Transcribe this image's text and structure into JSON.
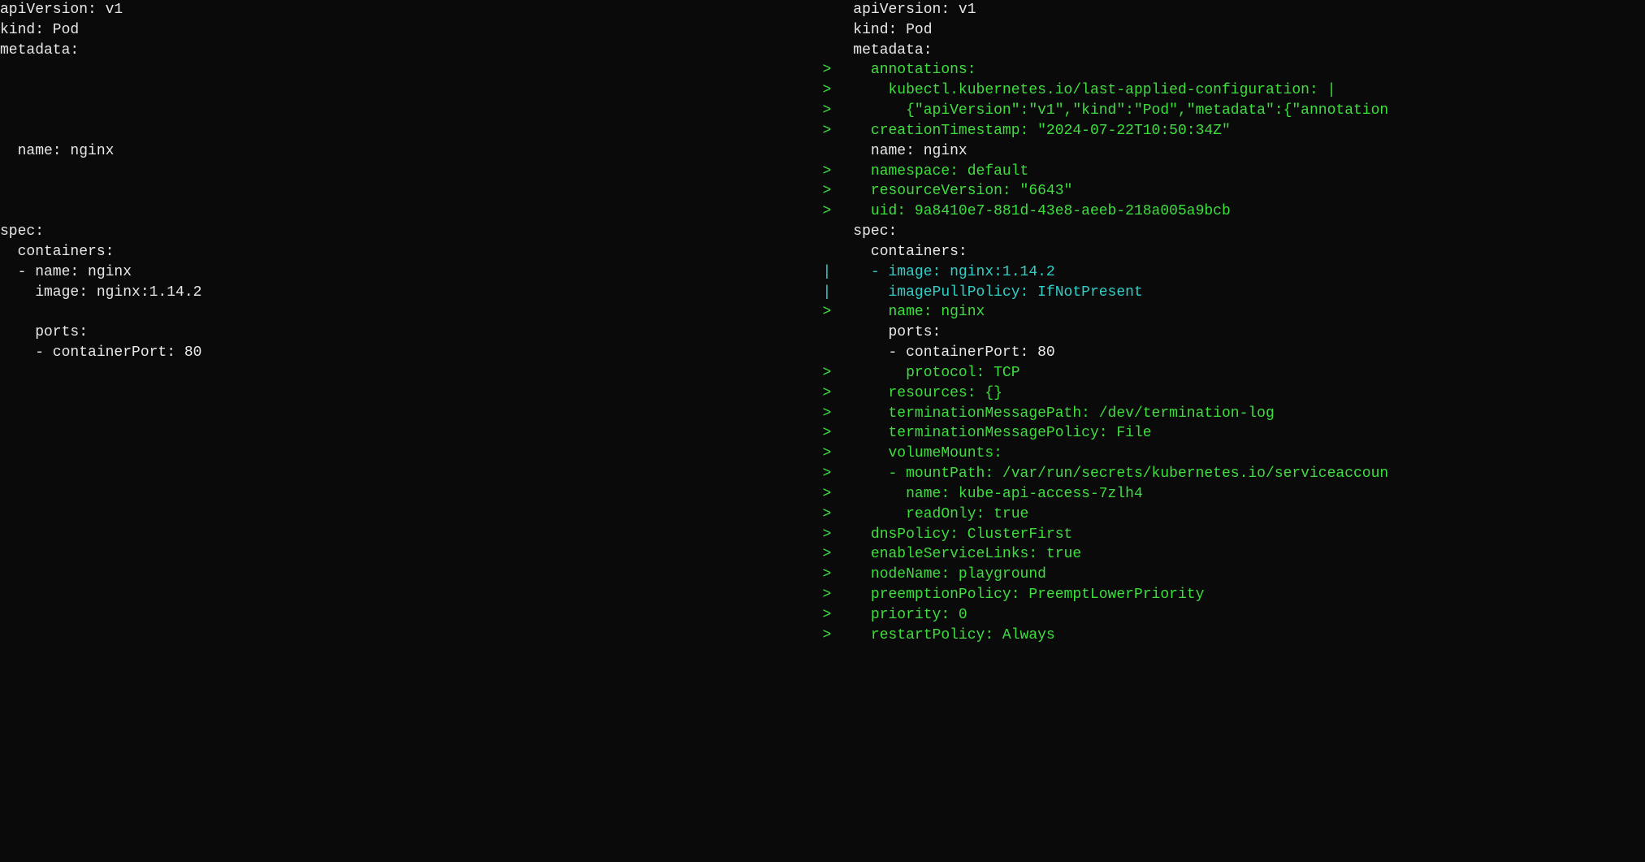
{
  "left": {
    "lines": [
      {
        "marker": "",
        "cls": "normal",
        "text": "apiVersion: v1"
      },
      {
        "marker": "",
        "cls": "normal",
        "text": "kind: Pod"
      },
      {
        "marker": "",
        "cls": "normal",
        "text": "metadata:"
      },
      {
        "marker": "",
        "cls": "normal",
        "text": ""
      },
      {
        "marker": "",
        "cls": "normal",
        "text": ""
      },
      {
        "marker": "",
        "cls": "normal",
        "text": ""
      },
      {
        "marker": "",
        "cls": "normal",
        "text": ""
      },
      {
        "marker": "",
        "cls": "normal",
        "text": "  name: nginx"
      },
      {
        "marker": "",
        "cls": "normal",
        "text": ""
      },
      {
        "marker": "",
        "cls": "normal",
        "text": ""
      },
      {
        "marker": "",
        "cls": "normal",
        "text": ""
      },
      {
        "marker": "",
        "cls": "normal",
        "text": "spec:"
      },
      {
        "marker": "",
        "cls": "normal",
        "text": "  containers:"
      },
      {
        "marker": "",
        "cls": "normal",
        "text": "  - name: nginx"
      },
      {
        "marker": "",
        "cls": "normal",
        "text": "    image: nginx:1.14.2"
      },
      {
        "marker": "",
        "cls": "normal",
        "text": ""
      },
      {
        "marker": "",
        "cls": "normal",
        "text": "    ports:"
      },
      {
        "marker": "",
        "cls": "normal",
        "text": "    - containerPort: 80"
      }
    ]
  },
  "right": {
    "lines": [
      {
        "marker": " ",
        "cls": "normal",
        "text": "apiVersion: v1"
      },
      {
        "marker": " ",
        "cls": "normal",
        "text": "kind: Pod"
      },
      {
        "marker": " ",
        "cls": "normal",
        "text": "metadata:"
      },
      {
        "marker": ">",
        "cls": "added",
        "text": "  annotations:"
      },
      {
        "marker": ">",
        "cls": "added",
        "text": "    kubectl.kubernetes.io/last-applied-configuration: |"
      },
      {
        "marker": ">",
        "cls": "added",
        "text": "      {\"apiVersion\":\"v1\",\"kind\":\"Pod\",\"metadata\":{\"annotation"
      },
      {
        "marker": ">",
        "cls": "added",
        "text": "  creationTimestamp: \"2024-07-22T10:50:34Z\""
      },
      {
        "marker": " ",
        "cls": "normal",
        "text": "  name: nginx"
      },
      {
        "marker": ">",
        "cls": "added",
        "text": "  namespace: default"
      },
      {
        "marker": ">",
        "cls": "added",
        "text": "  resourceVersion: \"6643\""
      },
      {
        "marker": ">",
        "cls": "added",
        "text": "  uid: 9a8410e7-881d-43e8-aeeb-218a005a9bcb"
      },
      {
        "marker": " ",
        "cls": "normal",
        "text": "spec:"
      },
      {
        "marker": " ",
        "cls": "normal",
        "text": "  containers:"
      },
      {
        "marker": "|",
        "cls": "changed",
        "text": "  - image: nginx:1.14.2"
      },
      {
        "marker": "|",
        "cls": "changed",
        "text": "    imagePullPolicy: IfNotPresent"
      },
      {
        "marker": ">",
        "cls": "added",
        "text": "    name: nginx"
      },
      {
        "marker": " ",
        "cls": "normal",
        "text": "    ports:"
      },
      {
        "marker": " ",
        "cls": "normal",
        "text": "    - containerPort: 80"
      },
      {
        "marker": ">",
        "cls": "added",
        "text": "      protocol: TCP"
      },
      {
        "marker": ">",
        "cls": "added",
        "text": "    resources: {}"
      },
      {
        "marker": ">",
        "cls": "added",
        "text": "    terminationMessagePath: /dev/termination-log"
      },
      {
        "marker": ">",
        "cls": "added",
        "text": "    terminationMessagePolicy: File"
      },
      {
        "marker": ">",
        "cls": "added",
        "text": "    volumeMounts:"
      },
      {
        "marker": ">",
        "cls": "added",
        "text": "    - mountPath: /var/run/secrets/kubernetes.io/serviceaccoun"
      },
      {
        "marker": ">",
        "cls": "added",
        "text": "      name: kube-api-access-7zlh4"
      },
      {
        "marker": ">",
        "cls": "added",
        "text": "      readOnly: true"
      },
      {
        "marker": ">",
        "cls": "added",
        "text": "  dnsPolicy: ClusterFirst"
      },
      {
        "marker": ">",
        "cls": "added",
        "text": "  enableServiceLinks: true"
      },
      {
        "marker": ">",
        "cls": "added",
        "text": "  nodeName: playground"
      },
      {
        "marker": ">",
        "cls": "added",
        "text": "  preemptionPolicy: PreemptLowerPriority"
      },
      {
        "marker": ">",
        "cls": "added",
        "text": "  priority: 0"
      },
      {
        "marker": ">",
        "cls": "added",
        "text": "  restartPolicy: Always"
      }
    ]
  }
}
